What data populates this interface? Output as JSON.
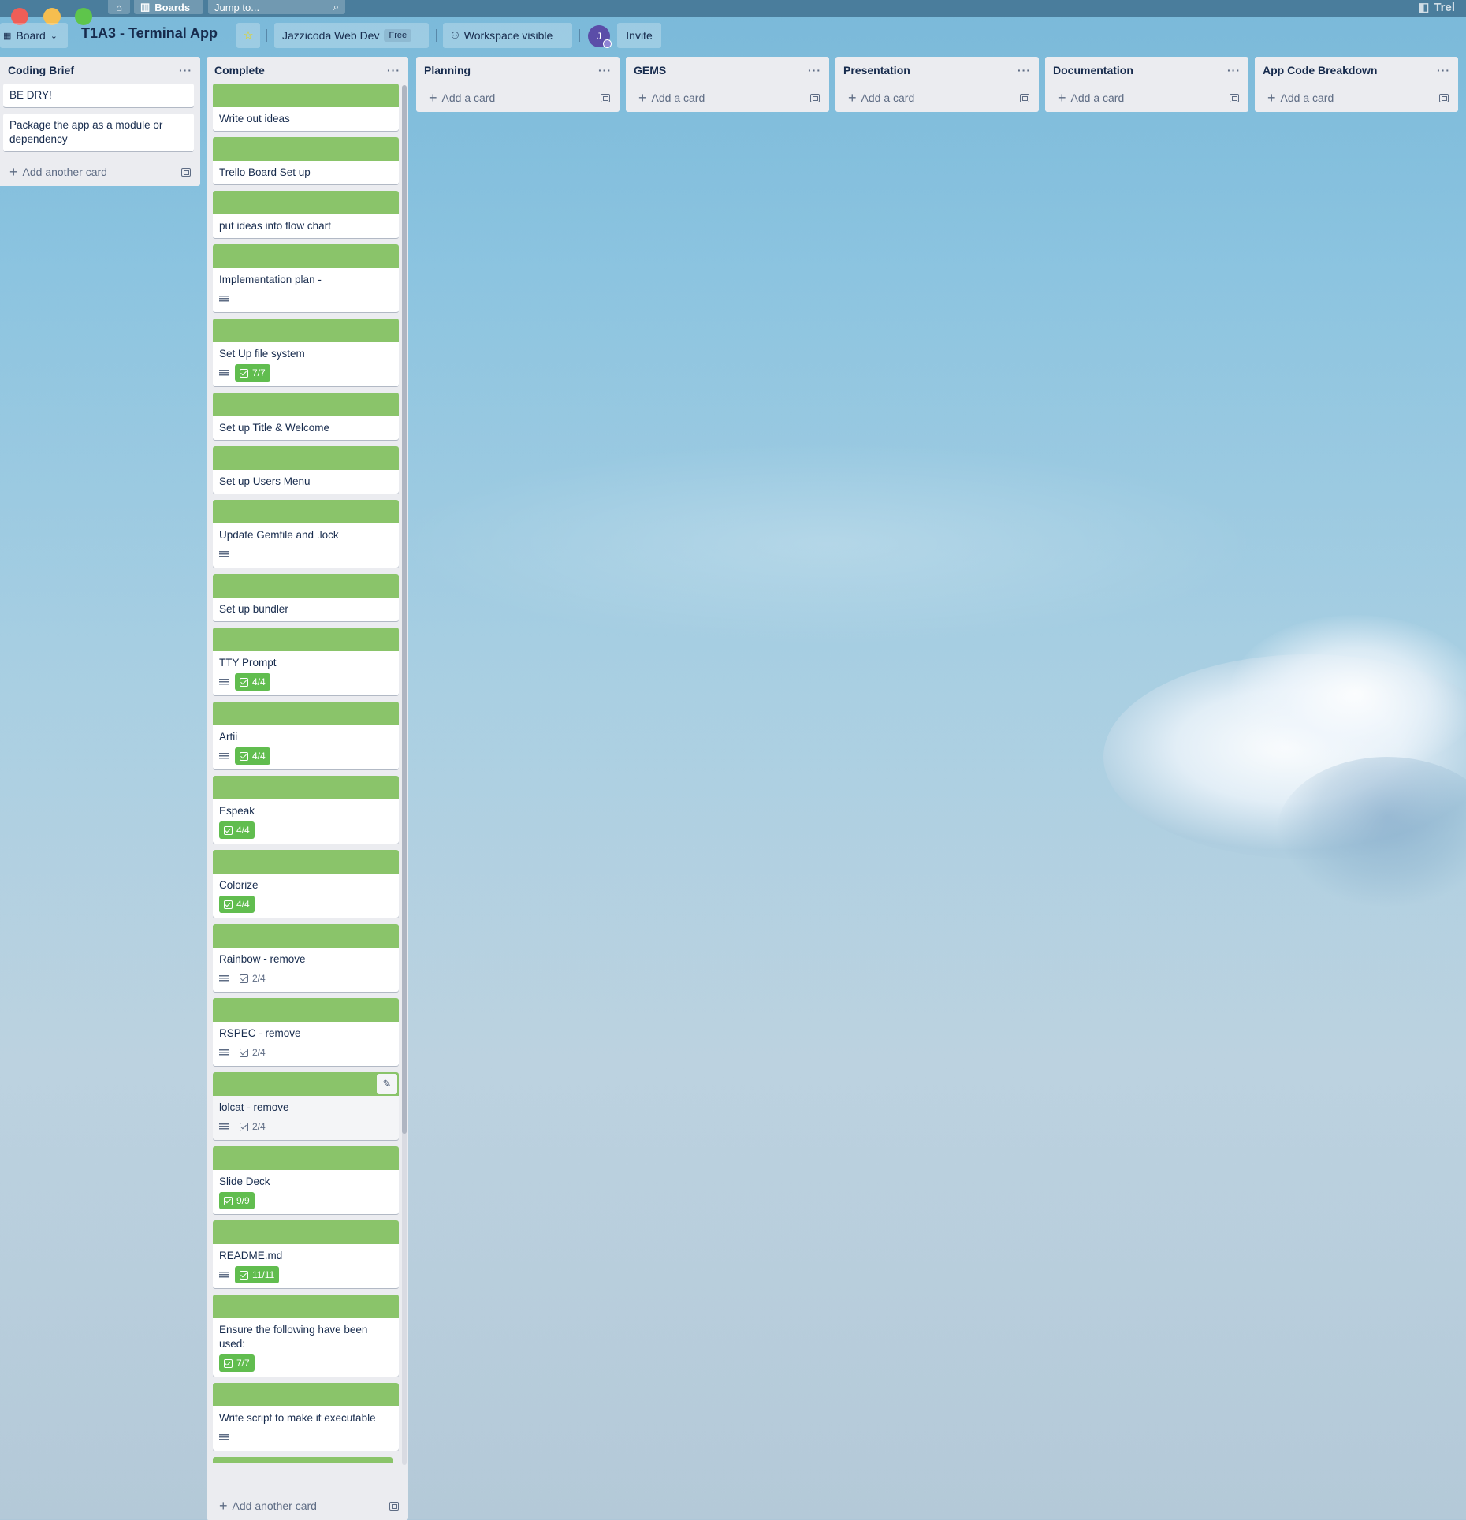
{
  "app": {
    "boards_label": "Boards",
    "search_placeholder": "Jump to...",
    "brand_partial": "Trel"
  },
  "header": {
    "board_switch_label": "Board",
    "title": "T1A3 - Terminal App",
    "workspace_name": "Jazzicoda Web Dev",
    "workspace_plan": "Free",
    "visibility_label": "Workspace visible",
    "avatar_initial": "J",
    "invite_label": "Invite"
  },
  "colors": {
    "label_green": "#8ac46a",
    "checklist_done": "#61bd4f",
    "list_bg": "#ebecf0"
  },
  "lists": [
    {
      "title": "Coding Brief",
      "add_label": "Add another card",
      "cards": [
        {
          "title": "BE DRY!"
        },
        {
          "title": "Package the app as a module or dependency"
        }
      ]
    },
    {
      "title": "Complete",
      "add_label": "Add another card",
      "cards": [
        {
          "title": "Write out ideas"
        },
        {
          "title": "Trello Board Set up"
        },
        {
          "title": "put ideas into flow chart"
        },
        {
          "title": "Implementation plan -",
          "has_description": true
        },
        {
          "title": "Set Up file system",
          "has_description": true,
          "checklist": "7/7"
        },
        {
          "title": "Set up Title & Welcome"
        },
        {
          "title": "Set up Users Menu"
        },
        {
          "title": "Update Gemfile and .lock",
          "has_description": true
        },
        {
          "title": "Set up bundler"
        },
        {
          "title": "TTY Prompt",
          "has_description": true,
          "checklist": "4/4"
        },
        {
          "title": "Artii",
          "has_description": true,
          "checklist": "4/4"
        },
        {
          "title": "Espeak",
          "checklist": "4/4"
        },
        {
          "title": "Colorize",
          "checklist": "4/4"
        },
        {
          "title": "Rainbow - remove",
          "has_description": true,
          "checklist": "2/4"
        },
        {
          "title": "RSPEC - remove",
          "has_description": true,
          "checklist": "2/4"
        },
        {
          "title": "lolcat - remove",
          "has_description": true,
          "checklist": "2/4"
        },
        {
          "title": "Slide Deck",
          "checklist": "9/9"
        },
        {
          "title": "README.md",
          "has_description": true,
          "checklist": "11/11"
        },
        {
          "title": "Ensure the following have been used:",
          "checklist": "7/7"
        },
        {
          "title": "Write script to make it executable",
          "has_description": true
        }
      ]
    },
    {
      "title": "Planning",
      "add_label": "Add a card"
    },
    {
      "title": "GEMS",
      "add_label": "Add a card"
    },
    {
      "title": "Presentation",
      "add_label": "Add a card"
    },
    {
      "title": "Documentation",
      "add_label": "Add a card"
    },
    {
      "title": "App Code Breakdown",
      "add_label": "Add a card"
    }
  ]
}
